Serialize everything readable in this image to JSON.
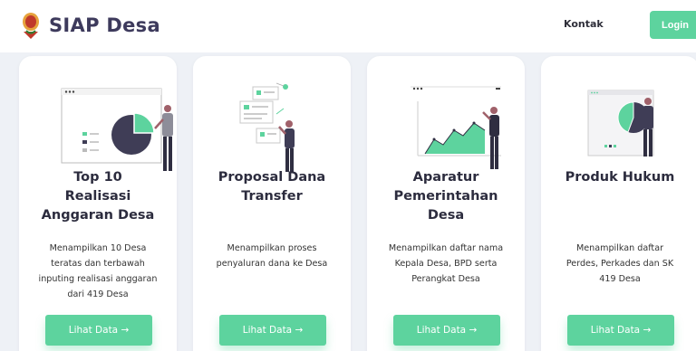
{
  "brand": {
    "name": "SIAP Desa",
    "logo_icon": "village-emblem-icon"
  },
  "nav": {
    "contact_label": "Kontak",
    "login_label": "Login"
  },
  "colors": {
    "accent": "#5dd39e",
    "title": "#2c2c3e",
    "brand_text": "#3d3a5c",
    "background": "#eef1f6"
  },
  "cards": [
    {
      "title_lines": [
        "Top 10",
        "Realisasi",
        "Anggaran Desa"
      ],
      "desc_lines": [
        "Menampilkan 10 Desa",
        "teratas dan terbawah",
        "inputing realisasi anggaran",
        "dari 419 Desa"
      ],
      "button_label": "Lihat Data →",
      "illustration": "pie-chart-presentation-icon"
    },
    {
      "title_lines": [
        "Proposal Dana",
        "Transfer"
      ],
      "desc_lines": [
        "Menampilkan proses",
        "penyaluran dana ke Desa"
      ],
      "button_label": "Lihat Data →",
      "illustration": "document-transfer-icon"
    },
    {
      "title_lines": [
        "Aparatur",
        "Pemerintahan",
        "Desa"
      ],
      "desc_lines": [
        "Menampilkan daftar nama",
        "Kepala Desa, BPD serta",
        "Perangkat Desa"
      ],
      "button_label": "Lihat Data →",
      "illustration": "area-chart-presentation-icon"
    },
    {
      "title_lines": [
        "Produk Hukum"
      ],
      "desc_lines": [
        "Menampilkan daftar",
        "Perdes, Perkades dan SK",
        "419 Desa"
      ],
      "button_label": "Lihat Data →",
      "illustration": "pie-chart-board-icon"
    }
  ]
}
